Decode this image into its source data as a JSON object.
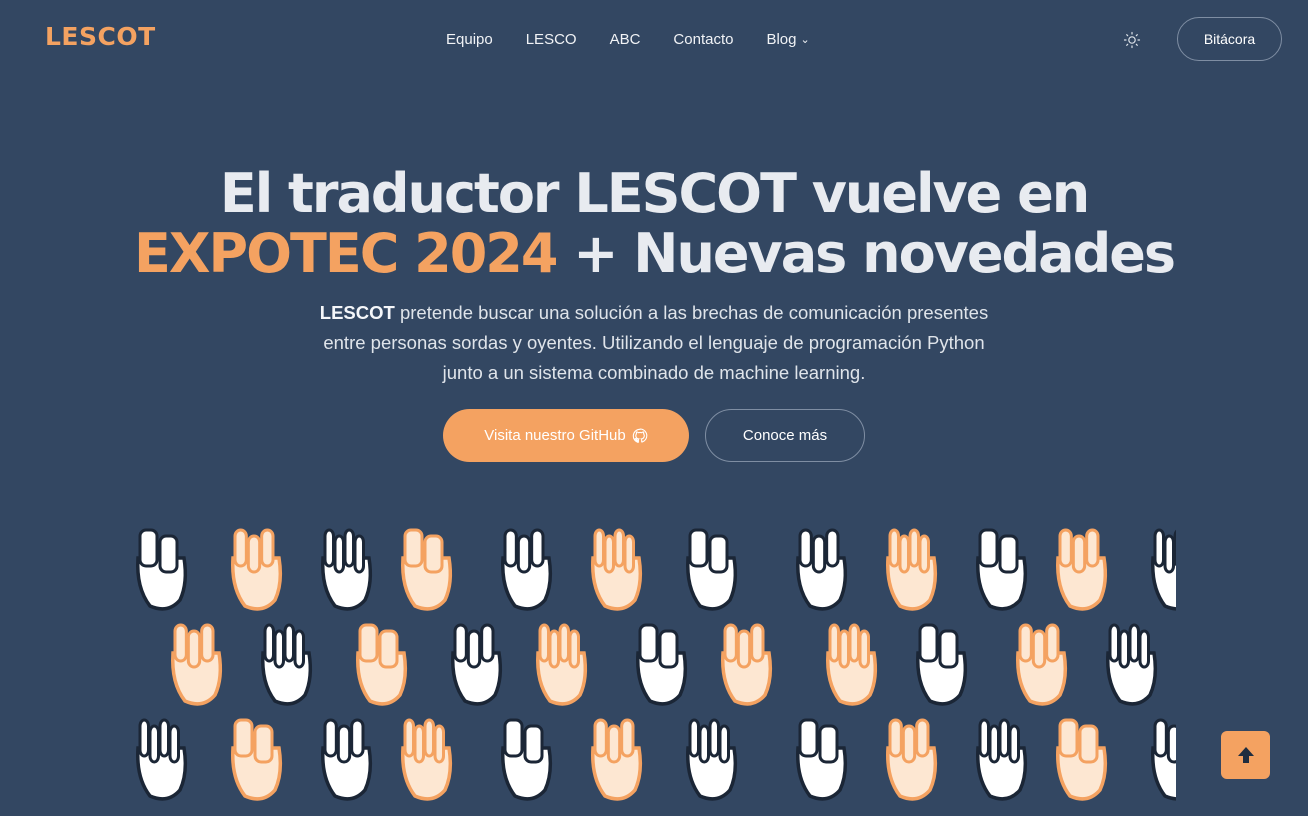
{
  "header": {
    "logo_text": "LESCOT",
    "nav": [
      {
        "label": "Equipo"
      },
      {
        "label": "LESCO"
      },
      {
        "label": "ABC"
      },
      {
        "label": "Contacto"
      },
      {
        "label": "Blog"
      }
    ],
    "theme_icon": "sun-icon",
    "cta_label": "Bitácora"
  },
  "hero": {
    "title_line1": "El traductor LESCOT vuelve en",
    "title_accent": "EXPOTEC 2024",
    "title_rest": " + Nuevas novedades",
    "subtitle_brand": "LESCOT",
    "subtitle_line1": " pretende buscar una solución a las brechas de comunicación presentes",
    "subtitle_line2": "entre personas sordas y oyentes. Utilizando el lenguaje de programación Python",
    "subtitle_line3": "junto a un sistema combinado de machine learning.",
    "primary_button": "Visita nuestro GitHub",
    "secondary_button": "Conoce más"
  },
  "illustration": {
    "icon": "sign-language-hands-illustration"
  },
  "colors": {
    "background": "#334762",
    "accent": "#f4a261",
    "text": "#e8ebf0"
  },
  "scroll_top_icon": "arrow-up-icon"
}
